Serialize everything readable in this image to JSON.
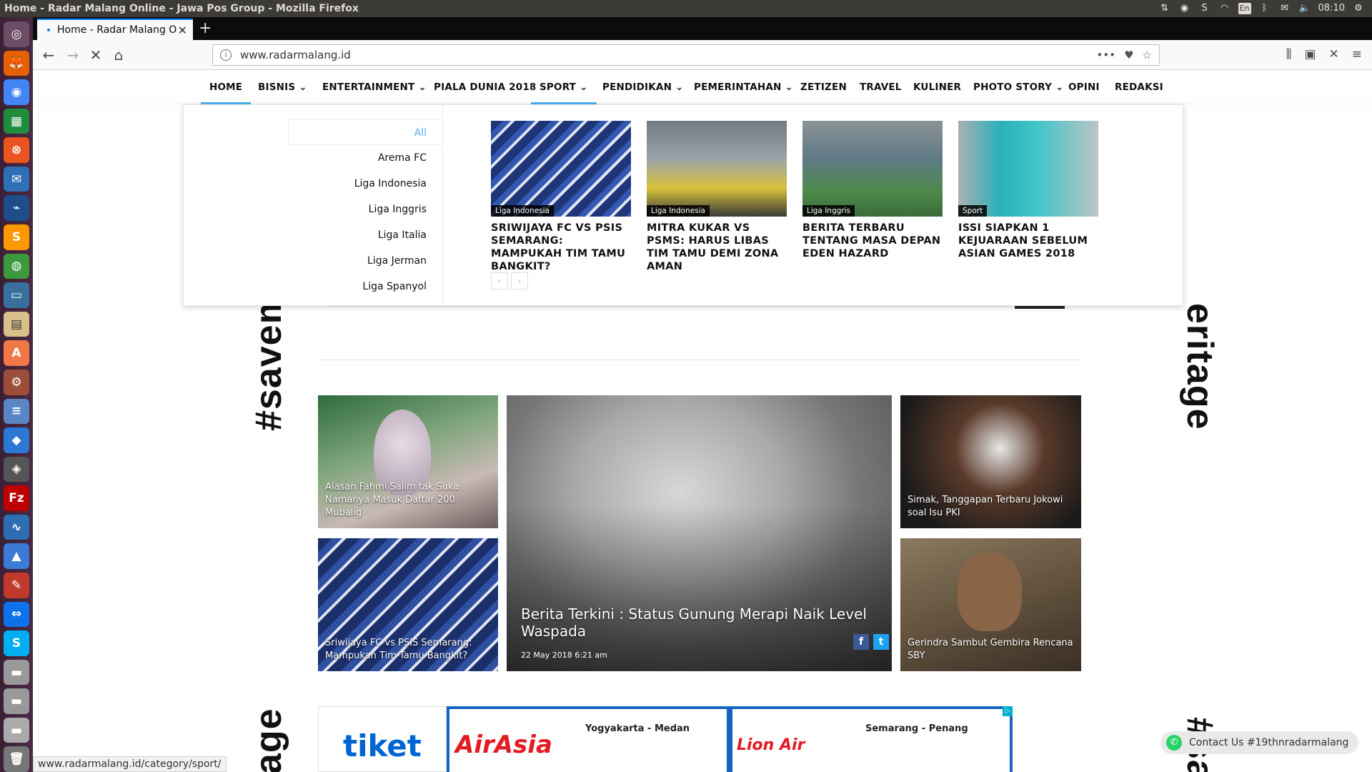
{
  "window": {
    "title": "Home - Radar Malang Online - Jawa Pos Group - Mozilla Firefox"
  },
  "system_tray": {
    "keyboard": "En",
    "clock": "08:10"
  },
  "browser": {
    "tab_title": "Home - Radar Malang O",
    "url": "www.radarmalang.id",
    "status_url": "www.radarmalang.id/category/sport/"
  },
  "site_nav": [
    "HOME",
    "BISNIS",
    "ENTERTAINMENT",
    "PIALA DUNIA 2018",
    "SPORT",
    "PENDIDIKAN",
    "PEMERINTAHAN",
    "ZETIZEN",
    "TRAVEL",
    "KULINER",
    "PHOTO STORY",
    "OPINI",
    "REDAKSI"
  ],
  "mega_menu": {
    "subcategories": [
      "All",
      "Arema FC",
      "Liga Indonesia",
      "Liga Inggris",
      "Liga Italia",
      "Liga Jerman",
      "Liga Spanyol"
    ],
    "posts": [
      {
        "category": "Liga Indonesia",
        "title": "SRIWIJAYA FC VS PSIS SEMARANG: MAMPUKAH TIM TAMU BANGKIT?"
      },
      {
        "category": "Liga Indonesia",
        "title": "MITRA KUKAR VS PSMS: HARUS LIBAS TIM TAMU DEMI ZONA AMAN"
      },
      {
        "category": "Liga Inggris",
        "title": "BERITA TERBARU TENTANG MASA DEPAN EDEN HAZARD"
      },
      {
        "category": "Sport",
        "title": "ISSI SIAPKAN 1 KEJUARAAN SEBELUM ASIAN GAMES 2018"
      }
    ],
    "prev": "‹",
    "next": "›"
  },
  "side_text": {
    "left_top": "#savema",
    "right_top": "eritage",
    "left_bottom": "age",
    "right_bottom": "#sa"
  },
  "grid": {
    "left_top": "Alasan Fahmi Salim tak Suka Namanya Masuk Daftar 200 Mubalig",
    "left_bottom": "Sriwijaya FC vs PSIS Semarang: Mampukah Tim Tamu Bangkit?",
    "center_title": "Berita Terkini : Status Gunung Merapi Naik Level Waspada",
    "center_date": "22 May 2018 6:21 am",
    "right_top": "Simak, Tanggapan Terbaru Jokowi soal Isu PKI",
    "right_bottom": "Gerindra Sambut Gembira Rencana SBY"
  },
  "ads": {
    "brand1": "tiket",
    "airline1": "AirAsia",
    "route1": "Yogyakarta - Medan",
    "airline2": "Lion Air",
    "route2": "Semarang - Penang"
  },
  "contact": "Contact Us #19thnradarmalang"
}
